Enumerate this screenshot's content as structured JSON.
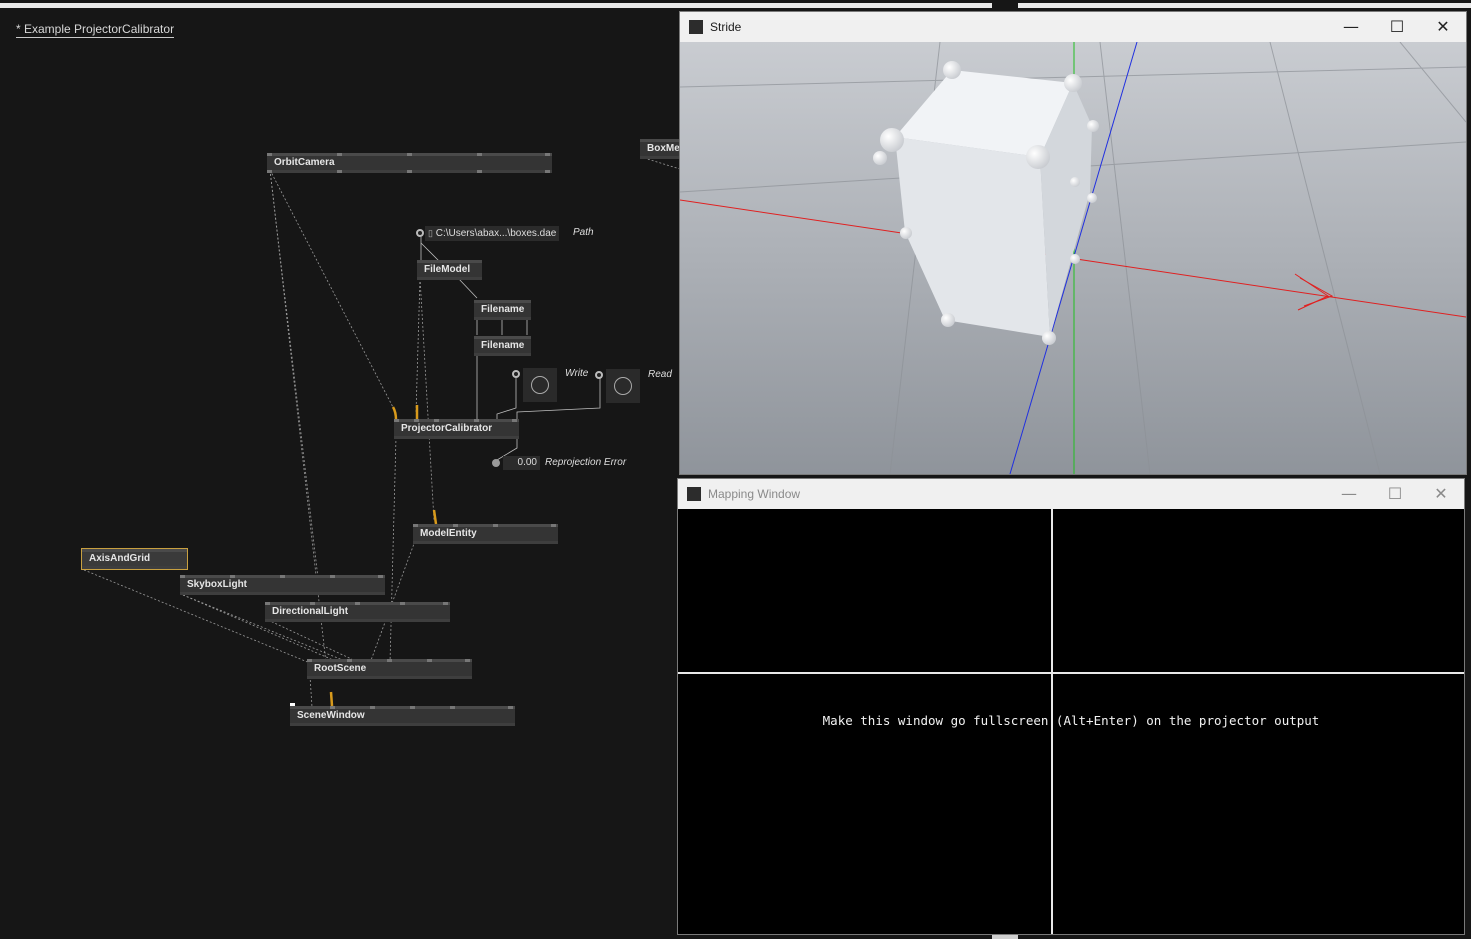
{
  "patch": {
    "title": "* Example ProjectorCalibrator",
    "nodes": {
      "orbit_camera": "OrbitCamera",
      "box_mesh": "BoxMe",
      "file_model": "FileModel",
      "filename_1": "Filename",
      "filename_2": "Filename",
      "projector_calibrator": "ProjectorCalibrator",
      "model_entity": "ModelEntity",
      "axis_and_grid": "AxisAndGrid",
      "skybox_light": "SkyboxLight",
      "directional_light": "DirectionalLight",
      "root_scene": "RootScene",
      "scene_window": "SceneWindow"
    },
    "path_value": "C:\\Users\\abax...\\boxes.dae",
    "path_label": "Path",
    "write_label": "Write",
    "read_label": "Read",
    "reprojection_value": "0.00",
    "reprojection_label": "Reprojection Error"
  },
  "stride_window": {
    "title": "Stride",
    "controls": {
      "minimize": "—",
      "maximize": "☐",
      "close": "✕"
    }
  },
  "mapping_window": {
    "title": "Mapping Window",
    "controls": {
      "minimize": "—",
      "maximize": "☐",
      "close": "✕"
    },
    "message": "Make this window go fullscreen (Alt+Enter) on the projector output"
  },
  "colors": {
    "background": "#161616",
    "node": "#343434",
    "link_active": "#d89a1c",
    "axis_x": "#e02020",
    "axis_y": "#20c020",
    "axis_z": "#2030e0"
  }
}
